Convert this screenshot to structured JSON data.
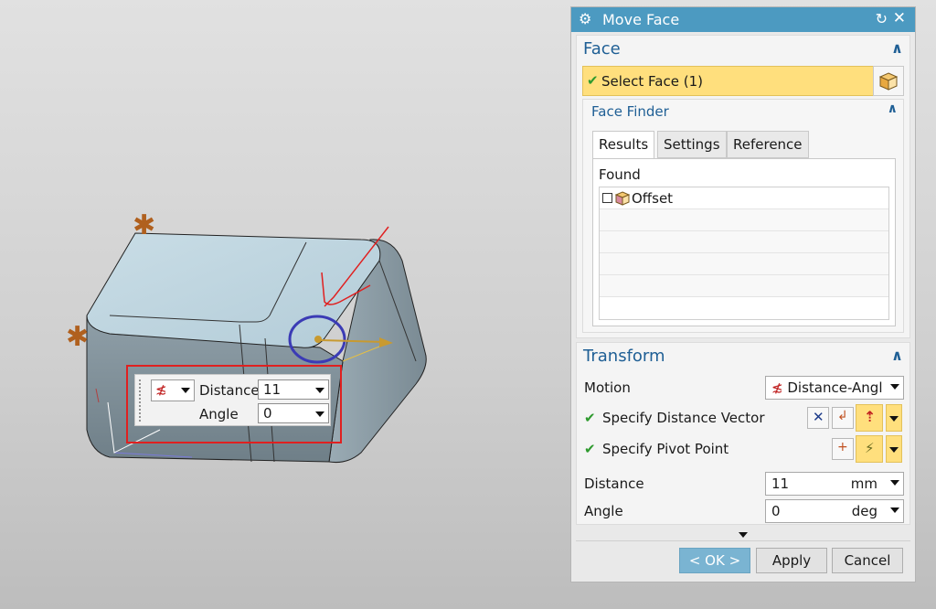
{
  "dialog": {
    "title": "Move Face",
    "face_group": {
      "header": "Face",
      "select_face_label": "Select Face (1)",
      "face_finder": {
        "header": "Face Finder",
        "tabs": [
          "Results",
          "Settings",
          "Reference"
        ],
        "active_tab": "Results",
        "found_label": "Found",
        "results": [
          "Offset"
        ]
      }
    },
    "transform_group": {
      "header": "Transform",
      "motion_label": "Motion",
      "motion_value": "Distance-Angl",
      "distance_vector_label": "Specify Distance Vector",
      "pivot_point_label": "Specify Pivot Point",
      "distance_label": "Distance",
      "distance_value": "11",
      "distance_unit": "mm",
      "angle_label": "Angle",
      "angle_value": "0",
      "angle_unit": "deg"
    },
    "footer": {
      "ok_label": "< OK >",
      "apply_label": "Apply",
      "cancel_label": "Cancel"
    }
  },
  "on_screen_input": {
    "distance_label": "Distance",
    "distance_value": "11",
    "angle_label": "Angle",
    "angle_value": "0"
  },
  "colors": {
    "titlebar": "#4c9ac1",
    "header_text": "#1f5f95",
    "selection_highlight": "#ffdf7d",
    "ok_button": "#7ab4d2",
    "check_green": "#2e9a2e",
    "annotation_red": "#e02020",
    "pivot_ring": "#3b3bb5",
    "star_marker": "#b0601e"
  },
  "icons": {
    "gear": "gear-icon",
    "reset": "reset-icon",
    "close": "close-icon",
    "check": "check-icon",
    "cube": "cube-icon"
  }
}
